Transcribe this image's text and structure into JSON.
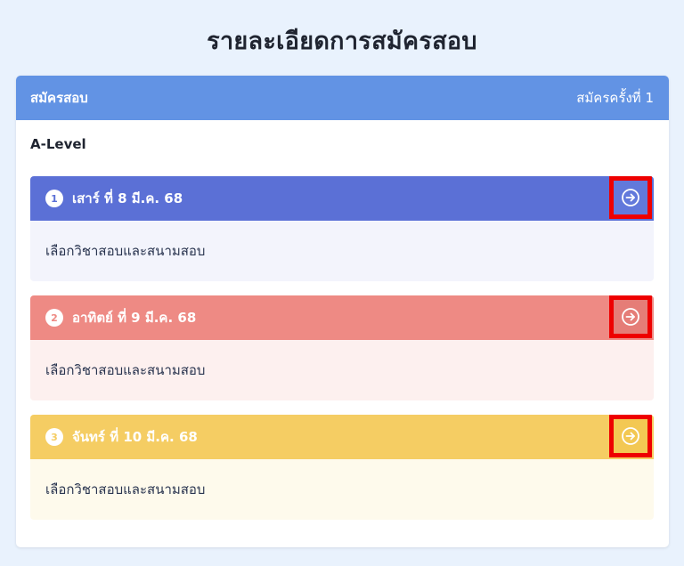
{
  "page": {
    "title": "รายละเอียดการสมัครสอบ"
  },
  "card": {
    "header_left": "สมัครสอบ",
    "header_right": "สมัครครั้งที่ 1",
    "level": "A-Level"
  },
  "days": [
    {
      "number": "1",
      "title": "เสาร์ ที่ 8 มี.ค. 68",
      "body": "เลือกวิชาสอบและสนามสอบ",
      "head_color": "#5b70d6",
      "body_color": "#f3f4fc",
      "button_color": "#6279db",
      "num_color": "#5b70d6",
      "action_icon": "arrow-right-circle-icon"
    },
    {
      "number": "2",
      "title": "อาทิตย์ ที่ 9 มี.ค. 68",
      "body": "เลือกวิชาสอบและสนามสอบ",
      "head_color": "#ee8a84",
      "body_color": "#fdf0ef",
      "button_color": "#e57d77",
      "num_color": "#ee8a84",
      "action_icon": "arrow-right-circle-icon"
    },
    {
      "number": "3",
      "title": "จันทร์ ที่ 10 มี.ค. 68",
      "body": "เลือกวิชาสอบและสนามสอบ",
      "head_color": "#f5cd63",
      "body_color": "#fefaec",
      "button_color": "#f3c853",
      "num_color": "#f5cd63",
      "action_icon": "arrow-right-circle-icon"
    }
  ],
  "colors": {
    "page_background": "#e9f2fd",
    "card_header": "#6293e4",
    "highlight_outline": "#ee0000"
  }
}
